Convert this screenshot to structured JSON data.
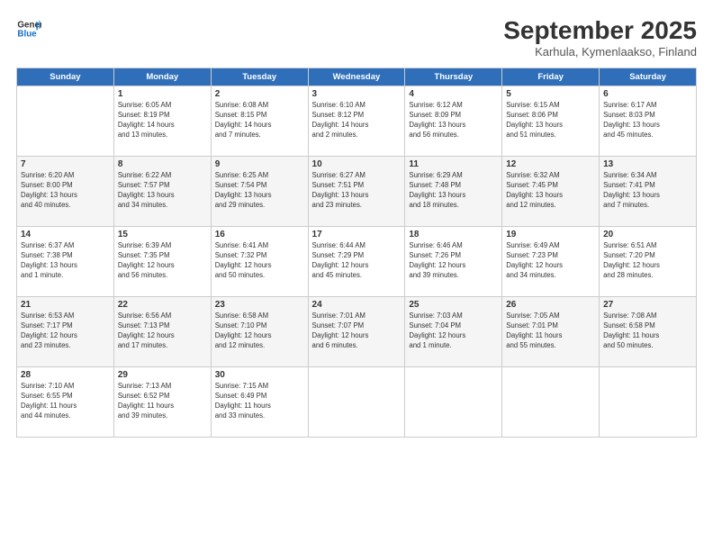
{
  "header": {
    "logo_line1": "General",
    "logo_line2": "Blue",
    "month": "September 2025",
    "location": "Karhula, Kymenlaakso, Finland"
  },
  "days_of_week": [
    "Sunday",
    "Monday",
    "Tuesday",
    "Wednesday",
    "Thursday",
    "Friday",
    "Saturday"
  ],
  "weeks": [
    [
      {
        "day": "",
        "info": ""
      },
      {
        "day": "1",
        "info": "Sunrise: 6:05 AM\nSunset: 8:19 PM\nDaylight: 14 hours\nand 13 minutes."
      },
      {
        "day": "2",
        "info": "Sunrise: 6:08 AM\nSunset: 8:15 PM\nDaylight: 14 hours\nand 7 minutes."
      },
      {
        "day": "3",
        "info": "Sunrise: 6:10 AM\nSunset: 8:12 PM\nDaylight: 14 hours\nand 2 minutes."
      },
      {
        "day": "4",
        "info": "Sunrise: 6:12 AM\nSunset: 8:09 PM\nDaylight: 13 hours\nand 56 minutes."
      },
      {
        "day": "5",
        "info": "Sunrise: 6:15 AM\nSunset: 8:06 PM\nDaylight: 13 hours\nand 51 minutes."
      },
      {
        "day": "6",
        "info": "Sunrise: 6:17 AM\nSunset: 8:03 PM\nDaylight: 13 hours\nand 45 minutes."
      }
    ],
    [
      {
        "day": "7",
        "info": "Sunrise: 6:20 AM\nSunset: 8:00 PM\nDaylight: 13 hours\nand 40 minutes."
      },
      {
        "day": "8",
        "info": "Sunrise: 6:22 AM\nSunset: 7:57 PM\nDaylight: 13 hours\nand 34 minutes."
      },
      {
        "day": "9",
        "info": "Sunrise: 6:25 AM\nSunset: 7:54 PM\nDaylight: 13 hours\nand 29 minutes."
      },
      {
        "day": "10",
        "info": "Sunrise: 6:27 AM\nSunset: 7:51 PM\nDaylight: 13 hours\nand 23 minutes."
      },
      {
        "day": "11",
        "info": "Sunrise: 6:29 AM\nSunset: 7:48 PM\nDaylight: 13 hours\nand 18 minutes."
      },
      {
        "day": "12",
        "info": "Sunrise: 6:32 AM\nSunset: 7:45 PM\nDaylight: 13 hours\nand 12 minutes."
      },
      {
        "day": "13",
        "info": "Sunrise: 6:34 AM\nSunset: 7:41 PM\nDaylight: 13 hours\nand 7 minutes."
      }
    ],
    [
      {
        "day": "14",
        "info": "Sunrise: 6:37 AM\nSunset: 7:38 PM\nDaylight: 13 hours\nand 1 minute."
      },
      {
        "day": "15",
        "info": "Sunrise: 6:39 AM\nSunset: 7:35 PM\nDaylight: 12 hours\nand 56 minutes."
      },
      {
        "day": "16",
        "info": "Sunrise: 6:41 AM\nSunset: 7:32 PM\nDaylight: 12 hours\nand 50 minutes."
      },
      {
        "day": "17",
        "info": "Sunrise: 6:44 AM\nSunset: 7:29 PM\nDaylight: 12 hours\nand 45 minutes."
      },
      {
        "day": "18",
        "info": "Sunrise: 6:46 AM\nSunset: 7:26 PM\nDaylight: 12 hours\nand 39 minutes."
      },
      {
        "day": "19",
        "info": "Sunrise: 6:49 AM\nSunset: 7:23 PM\nDaylight: 12 hours\nand 34 minutes."
      },
      {
        "day": "20",
        "info": "Sunrise: 6:51 AM\nSunset: 7:20 PM\nDaylight: 12 hours\nand 28 minutes."
      }
    ],
    [
      {
        "day": "21",
        "info": "Sunrise: 6:53 AM\nSunset: 7:17 PM\nDaylight: 12 hours\nand 23 minutes."
      },
      {
        "day": "22",
        "info": "Sunrise: 6:56 AM\nSunset: 7:13 PM\nDaylight: 12 hours\nand 17 minutes."
      },
      {
        "day": "23",
        "info": "Sunrise: 6:58 AM\nSunset: 7:10 PM\nDaylight: 12 hours\nand 12 minutes."
      },
      {
        "day": "24",
        "info": "Sunrise: 7:01 AM\nSunset: 7:07 PM\nDaylight: 12 hours\nand 6 minutes."
      },
      {
        "day": "25",
        "info": "Sunrise: 7:03 AM\nSunset: 7:04 PM\nDaylight: 12 hours\nand 1 minute."
      },
      {
        "day": "26",
        "info": "Sunrise: 7:05 AM\nSunset: 7:01 PM\nDaylight: 11 hours\nand 55 minutes."
      },
      {
        "day": "27",
        "info": "Sunrise: 7:08 AM\nSunset: 6:58 PM\nDaylight: 11 hours\nand 50 minutes."
      }
    ],
    [
      {
        "day": "28",
        "info": "Sunrise: 7:10 AM\nSunset: 6:55 PM\nDaylight: 11 hours\nand 44 minutes."
      },
      {
        "day": "29",
        "info": "Sunrise: 7:13 AM\nSunset: 6:52 PM\nDaylight: 11 hours\nand 39 minutes."
      },
      {
        "day": "30",
        "info": "Sunrise: 7:15 AM\nSunset: 6:49 PM\nDaylight: 11 hours\nand 33 minutes."
      },
      {
        "day": "",
        "info": ""
      },
      {
        "day": "",
        "info": ""
      },
      {
        "day": "",
        "info": ""
      },
      {
        "day": "",
        "info": ""
      }
    ]
  ]
}
